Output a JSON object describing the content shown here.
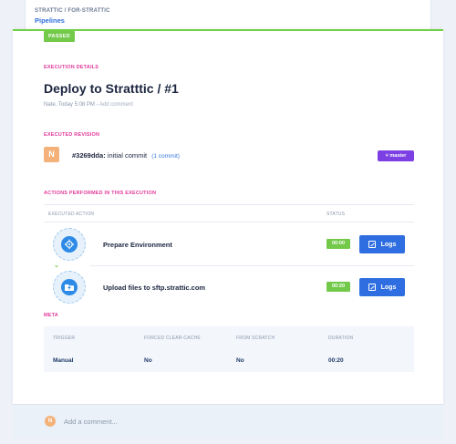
{
  "header": {
    "breadcrumb": "STRATTIC / FOR-STRATTIC",
    "section": "Pipelines"
  },
  "status": {
    "label": "PASSED",
    "color": "#72c94a"
  },
  "details": {
    "heading": "EXECUTION DETAILS",
    "title": "Deploy to Stratttic / #1",
    "author": "Nate, Today 5:08 PM",
    "separator": " - ",
    "add_comment": "Add comment"
  },
  "revision": {
    "heading": "EXECUTED REVISION",
    "avatar_initial": "N",
    "hash": "#3269dda:",
    "message": "initial commit",
    "commits": "(1 commit)",
    "branch": "master",
    "branch_icon": "branch-icon"
  },
  "actions": {
    "heading": "ACTIONS PERFORMED IN THIS EXECUTION",
    "col_action": "EXECUTED ACTION",
    "col_status": "STATUS",
    "items": [
      {
        "name": "Prepare Environment",
        "duration": "00:00",
        "logs_label": "Logs",
        "icon": "gear-sync-icon"
      },
      {
        "name": "Upload files to sftp.strattic.com",
        "duration": "00:20",
        "logs_label": "Logs",
        "icon": "folder-upload-icon"
      }
    ]
  },
  "meta": {
    "heading": "META",
    "columns": [
      "TRIGGER",
      "FORCED CLEAR-CACHE",
      "FROM SCRATCH",
      "DURATION"
    ],
    "values": [
      "Manual",
      "No",
      "No",
      "00:20"
    ]
  },
  "comment": {
    "avatar_initial": "N",
    "placeholder": "Add a comment..."
  }
}
